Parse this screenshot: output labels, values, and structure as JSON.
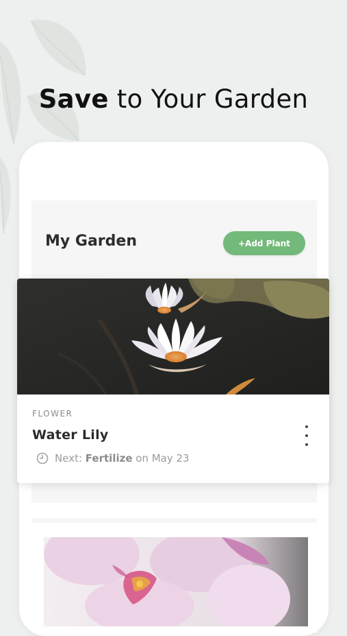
{
  "headline": {
    "bold": "Save",
    "rest": " to Your Garden"
  },
  "screen": {
    "title": "My Garden",
    "add_button": "+Add Plant"
  },
  "plant_card": {
    "category": "FLOWER",
    "name": "Water Lily",
    "next_prefix": "Next:",
    "next_task": "Fertilize",
    "next_suffix": "on May 23",
    "image": "water-lily-photo"
  },
  "second_card": {
    "image": "orchid-photo"
  },
  "colors": {
    "background": "#eef0ef",
    "accent_green": "#72b97a",
    "card": "#ffffff",
    "text_dark": "#2b2b2b",
    "text_muted": "#9b9b9b"
  },
  "icons": [
    "clock-icon",
    "more-vertical-icon"
  ]
}
